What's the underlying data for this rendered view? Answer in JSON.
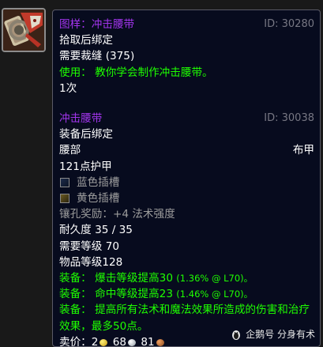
{
  "item_icon": "belt-pattern-icon",
  "pattern": {
    "name": "图样：冲击腰带",
    "id": "ID: 30280",
    "bind": "拾取后绑定",
    "requirement": "需要裁缝 (375)",
    "use": "使用： 教你学会制作冲击腰带。",
    "charges": "1次"
  },
  "item": {
    "name": "冲击腰带",
    "id": "ID: 30038",
    "bind": "装备后绑定",
    "slot": "腰部",
    "armor_type": "布甲",
    "armor": "121点护甲",
    "sockets": [
      {
        "color": "blue",
        "label": "蓝色插槽"
      },
      {
        "color": "yellow",
        "label": "黄色插槽"
      }
    ],
    "socket_bonus": "镶孔奖励：+4 法术强度",
    "durability": "耐久度 35 / 35",
    "required_level": "需要等级 70",
    "item_level": "物品等级128",
    "equip_effects": [
      {
        "text": "装备： 爆击等级提高30",
        "detail": "(1.36% @ L70)。"
      },
      {
        "text": "装备： 命中等级提高23",
        "detail": "(1.46% @ L70)。"
      },
      {
        "text": "装备： 提高所有法术和魔法效果所造成的伤害和治疗效果，最多50点。",
        "detail": ""
      }
    ],
    "sell_price": {
      "label": "卖价：",
      "gold": "2",
      "silver": "68",
      "copper": "81"
    }
  },
  "watermark": {
    "icon": "penguin-logo-icon",
    "text": "企鹅号 分身有术"
  },
  "colors": {
    "tooltip_bg": "#070b1e",
    "epic": "#a335ee",
    "green": "#1eff00",
    "grey": "#9d9d9d"
  }
}
